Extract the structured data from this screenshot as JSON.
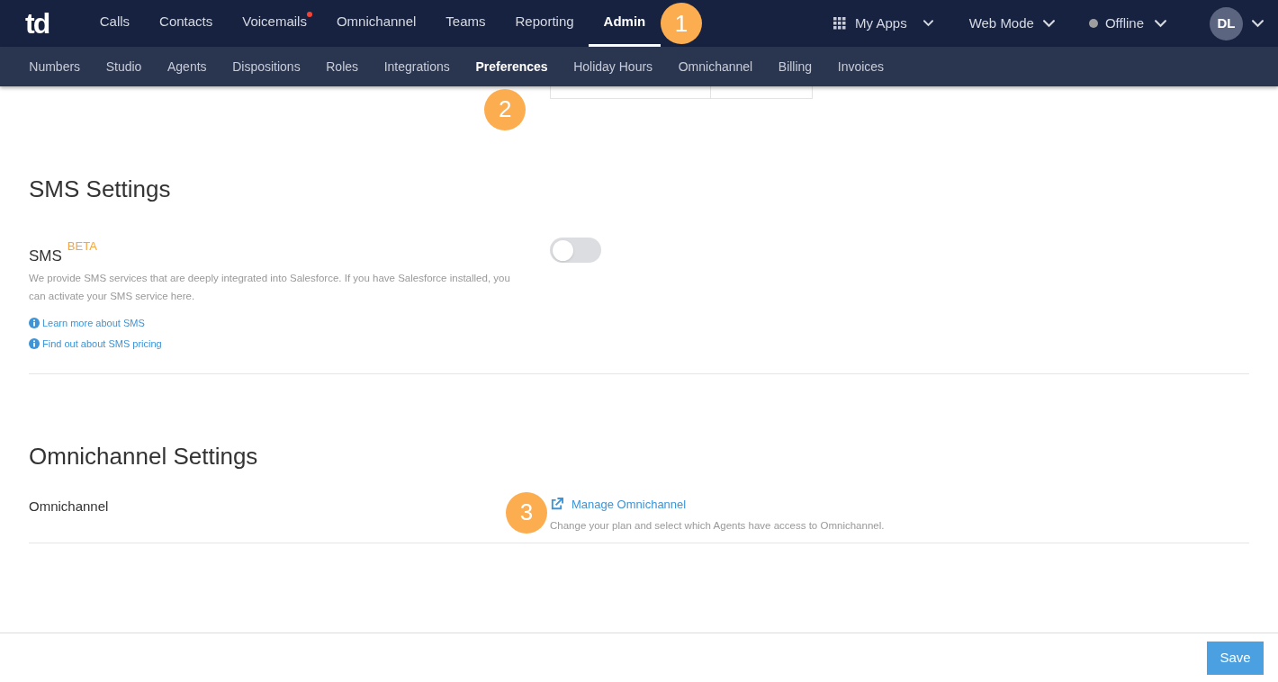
{
  "top_nav": {
    "logo": "td",
    "items": [
      {
        "label": "Calls",
        "selected": false,
        "notification": false
      },
      {
        "label": "Contacts",
        "selected": false,
        "notification": false
      },
      {
        "label": "Voicemails",
        "selected": false,
        "notification": true
      },
      {
        "label": "Omnichannel",
        "selected": false,
        "notification": false
      },
      {
        "label": "Teams",
        "selected": false,
        "notification": false
      },
      {
        "label": "Reporting",
        "selected": false,
        "notification": false
      },
      {
        "label": "Admin",
        "selected": true,
        "notification": false
      }
    ],
    "my_apps": "My Apps",
    "mode": "Web Mode",
    "status": {
      "label": "Offline",
      "color": "#9e9e9e"
    },
    "avatar": "DL"
  },
  "sub_nav": [
    {
      "label": "Numbers",
      "selected": false
    },
    {
      "label": "Studio",
      "selected": false
    },
    {
      "label": "Agents",
      "selected": false
    },
    {
      "label": "Dispositions",
      "selected": false
    },
    {
      "label": "Roles",
      "selected": false
    },
    {
      "label": "Integrations",
      "selected": false
    },
    {
      "label": "Preferences",
      "selected": true
    },
    {
      "label": "Holiday Hours",
      "selected": false
    },
    {
      "label": "Omnichannel",
      "selected": false
    },
    {
      "label": "Billing",
      "selected": false
    },
    {
      "label": "Invoices",
      "selected": false
    }
  ],
  "callouts": [
    "1",
    "2",
    "3"
  ],
  "sms_section": {
    "title": "SMS Settings",
    "label": "SMS",
    "badge": "BETA",
    "description": "We provide SMS services that are deeply integrated into Salesforce. If you have Salesforce installed, you can activate your SMS service here.",
    "links": [
      "Learn more about SMS",
      "Find out about SMS pricing"
    ],
    "on": false
  },
  "omnichannel_section": {
    "title": "Omnichannel Settings",
    "label": "Omnichannel",
    "link": "Manage Omnichannel",
    "description": "Change your plan and select which Agents have access to Omnichannel."
  },
  "footer": {
    "save": "Save"
  }
}
